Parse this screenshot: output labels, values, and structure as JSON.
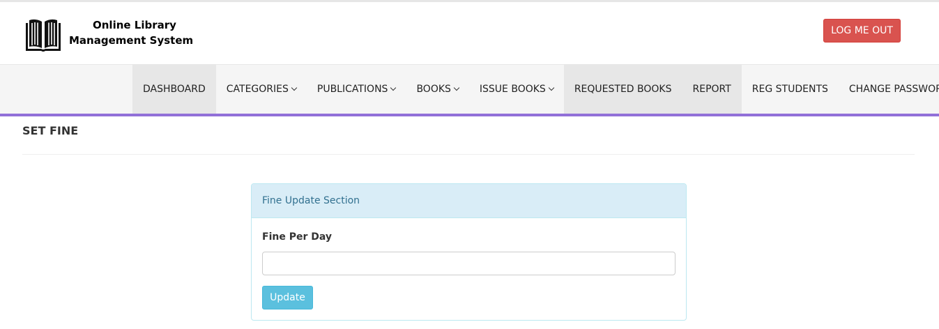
{
  "header": {
    "logo_icon": "open-book-icon",
    "brand_line1": "Online Library",
    "brand_line2": "Management System",
    "logout_label": "LOG ME OUT"
  },
  "nav": {
    "items": [
      {
        "label": "DASHBOARD",
        "dropdown": false
      },
      {
        "label": "CATEGORIES",
        "dropdown": true
      },
      {
        "label": "PUBLICATIONS",
        "dropdown": true
      },
      {
        "label": "BOOKS",
        "dropdown": true
      },
      {
        "label": "ISSUE BOOKS",
        "dropdown": true
      },
      {
        "label": "REQUESTED BOOKS",
        "dropdown": false
      },
      {
        "label": "REPORT",
        "dropdown": false
      },
      {
        "label": "REG STUDENTS",
        "dropdown": false
      },
      {
        "label": "CHANGE PASSWORD",
        "dropdown": false
      }
    ],
    "accent_color": "#9170d8"
  },
  "main": {
    "page_title": "SET FINE",
    "panel": {
      "heading": "Fine Update Section",
      "field_label": "Fine Per Day",
      "field_value": "",
      "field_placeholder": "",
      "update_label": "Update"
    }
  },
  "colors": {
    "logout": "#d9534f",
    "update": "#5bc0de",
    "panel_heading_bg": "#d9edf7"
  }
}
